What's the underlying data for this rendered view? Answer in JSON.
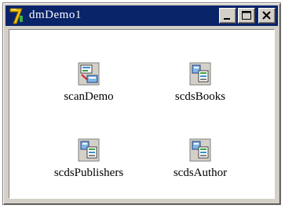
{
  "window": {
    "title": "dmDemo1",
    "app_icon": "app-logo-7-icon",
    "controls": {
      "minimize_icon": "minimize-icon",
      "maximize_icon": "maximize-icon",
      "close_icon": "close-icon"
    }
  },
  "items": [
    {
      "label": "scanDemo",
      "icon": "scanner-component-icon"
    },
    {
      "label": "scdsBooks",
      "icon": "dataset-component-icon"
    },
    {
      "label": "scdsPublishers",
      "icon": "dataset-component-icon"
    },
    {
      "label": "scdsAuthor",
      "icon": "dataset-component-icon"
    }
  ],
  "colors": {
    "titlebar": "#0a246a",
    "window_face": "#d4d0c8",
    "client_bg": "#ffffff"
  }
}
